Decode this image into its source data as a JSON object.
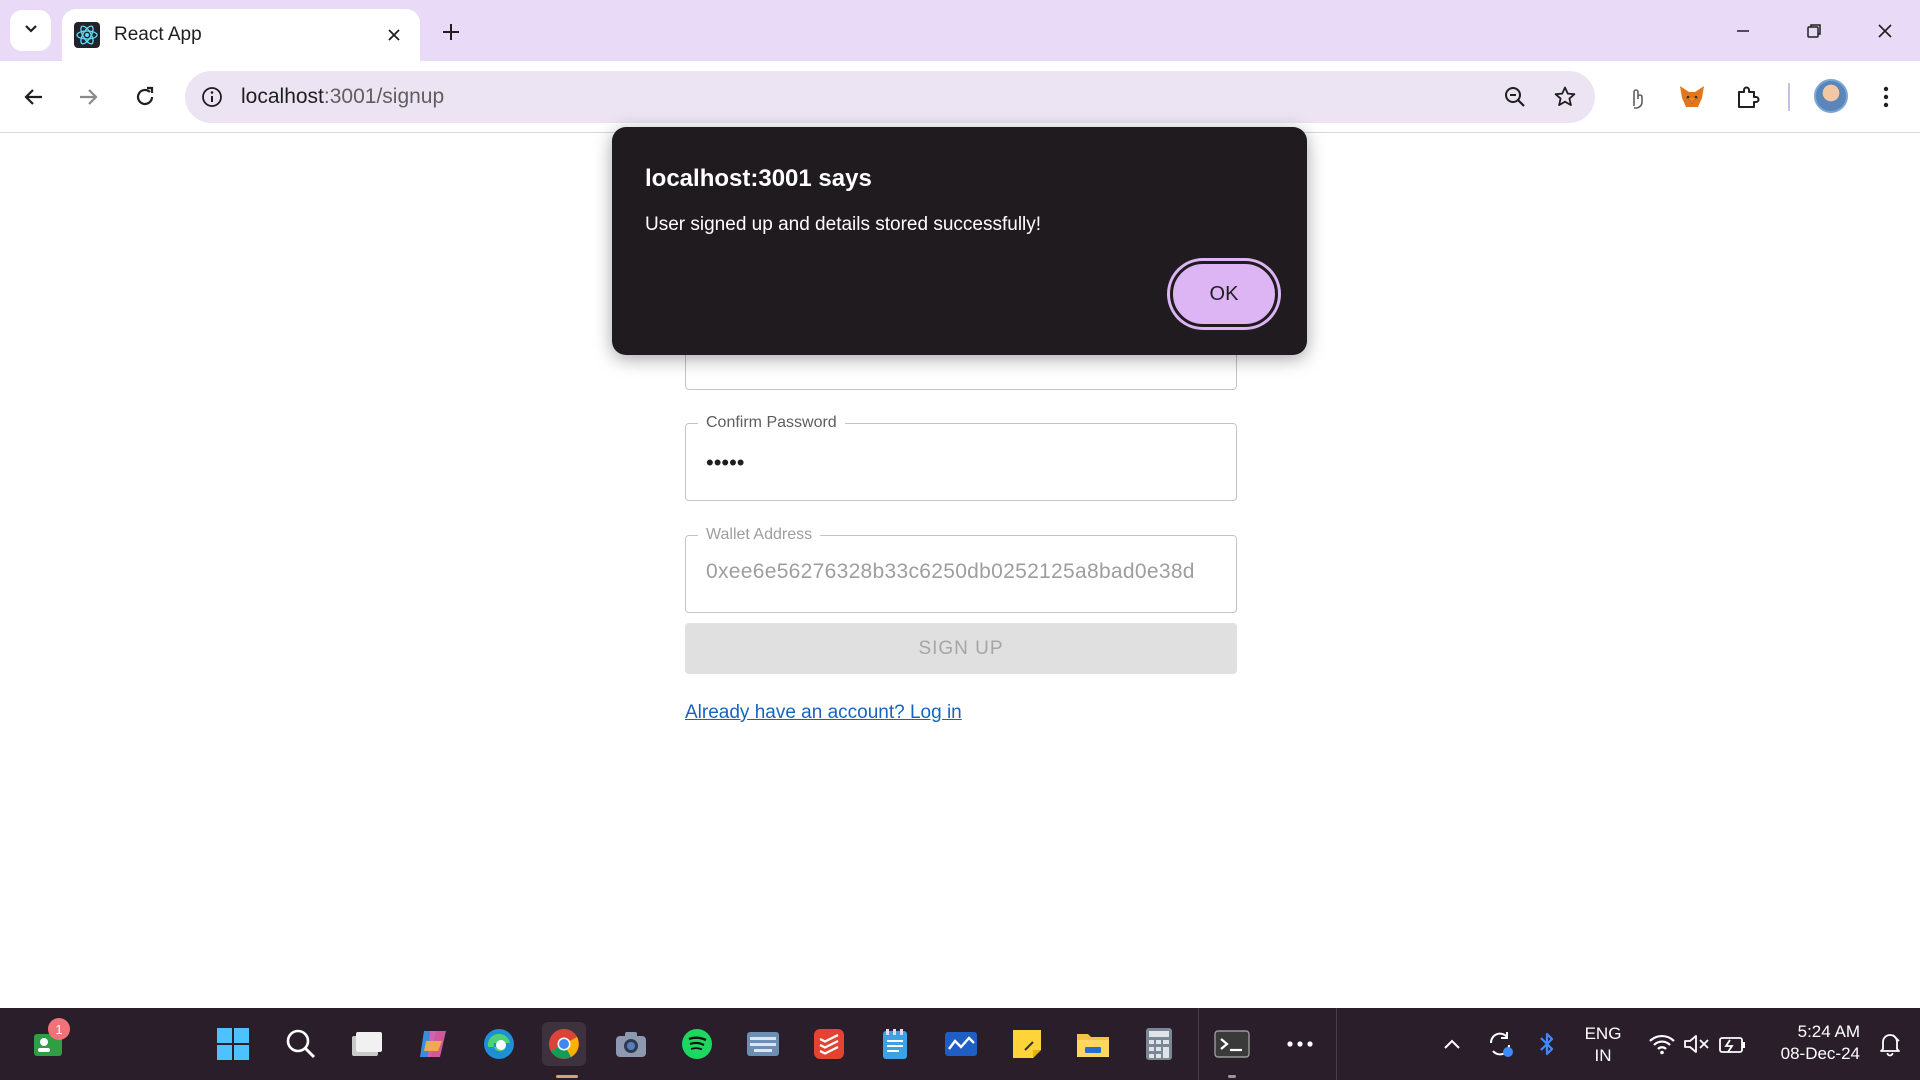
{
  "browser": {
    "tab": {
      "title": "React App"
    },
    "address_bar": {
      "host": "localhost",
      "rest": ":3001/signup"
    }
  },
  "form": {
    "confirm_password": {
      "label": "Confirm Password",
      "value": "•••••"
    },
    "wallet_address": {
      "label": "Wallet Address",
      "value": "0xee6e56276328b33c6250db0252125a8bad0e38d"
    },
    "signup_button": "SIGN UP",
    "login_link": "Already have an account? Log in"
  },
  "dialog": {
    "title": "localhost:3001 says",
    "message": "User signed up and details stored successfully!",
    "ok_label": "OK"
  },
  "taskbar": {
    "notification_count": "1",
    "lang_primary": "ENG",
    "lang_secondary": "IN",
    "time": "5:24 AM",
    "date": "08-Dec-24"
  },
  "colors": {
    "tabbar": "#e9dbf7",
    "omnibox": "#ece4f3",
    "dialog_bg": "#1f1b1f",
    "ok_button": "#ddb4f4",
    "link": "#1565c0",
    "taskbar": "#2a1e2b"
  }
}
